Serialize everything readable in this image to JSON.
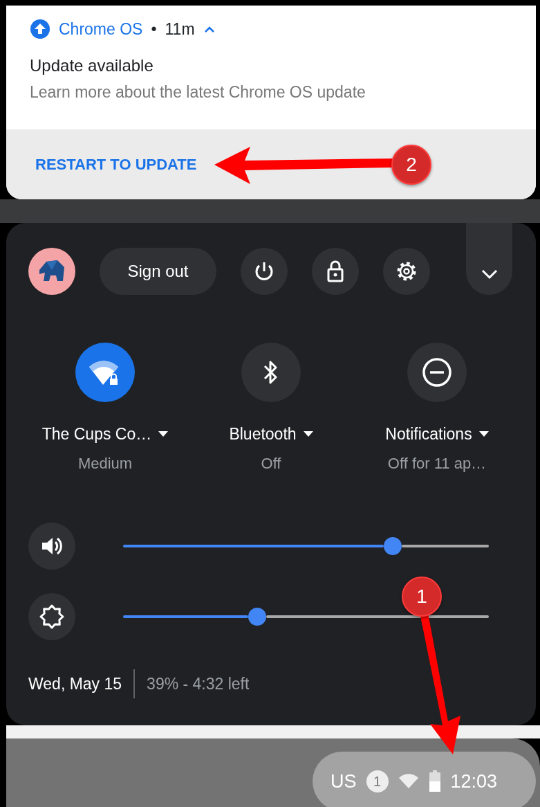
{
  "notification": {
    "app": "Chrome OS",
    "separator": "•",
    "time": "11m",
    "expanded": true,
    "title": "Update available",
    "message": "Learn more about the latest Chrome OS update",
    "action": "RESTART TO UPDATE"
  },
  "quick_settings": {
    "sign_out": "Sign out",
    "tiles": [
      {
        "kind": "network",
        "label": "The Cups Co…",
        "sublabel": "Medium",
        "on": true
      },
      {
        "kind": "bluetooth",
        "label": "Bluetooth",
        "sublabel": "Off",
        "on": false
      },
      {
        "kind": "notifications",
        "label": "Notifications",
        "sublabel": "Off for 11 ap…",
        "on": false
      }
    ],
    "sliders": [
      {
        "kind": "volume",
        "level": 0.737
      },
      {
        "kind": "brightness",
        "level": 0.367
      }
    ],
    "date": "Wed, May 15",
    "battery": "39% - 4:32 left"
  },
  "shelf": {
    "input_method": "US",
    "notification_count": "1",
    "time": "12:03"
  },
  "annotations": [
    {
      "kind": "left",
      "number": "2"
    },
    {
      "kind": "down",
      "number": "1"
    }
  ]
}
